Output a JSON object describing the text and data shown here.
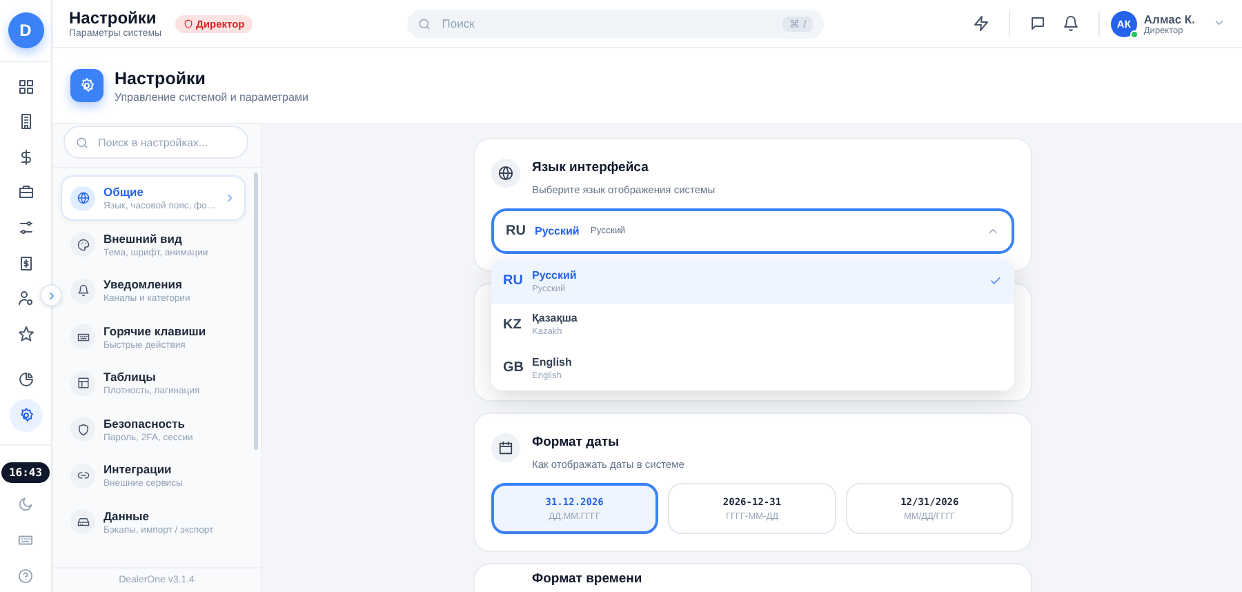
{
  "rail": {
    "logo": "D",
    "items": [
      {
        "selected": false
      },
      {
        "selected": false
      },
      {
        "selected": false
      },
      {
        "selected": false
      },
      {
        "selected": false
      },
      {
        "selected": false
      },
      {
        "selected": false
      },
      {
        "selected": false
      },
      {
        "selected": false
      },
      {
        "selected": true
      }
    ],
    "clock": "16:43"
  },
  "header": {
    "title": "Настройки",
    "subtitle": "Параметры системы",
    "role_badge": "Директор",
    "search": {
      "placeholder": "Поиск",
      "shortcut": "⌘ /"
    },
    "user": {
      "initials": "АК",
      "name": "Алмас К.",
      "role": "Директор",
      "online": true
    }
  },
  "page": {
    "title": "Настройки",
    "subtitle": "Управление системой и параметрами"
  },
  "settings_nav": {
    "search": {
      "placeholder": "Поиск в настройках..."
    },
    "items": [
      {
        "title": "Общие",
        "subtitle": "Язык, часовой пояс, фо...",
        "selected": true
      },
      {
        "title": "Внешний вид",
        "subtitle": "Тема, шрифт, анимации",
        "selected": false
      },
      {
        "title": "Уведомления",
        "subtitle": "Каналы и категории",
        "selected": false
      },
      {
        "title": "Горячие клавиши",
        "subtitle": "Быстрые действия",
        "selected": false
      },
      {
        "title": "Таблицы",
        "subtitle": "Плотность, пагинация",
        "selected": false
      },
      {
        "title": "Безопасность",
        "subtitle": "Пароль, 2FA, сессии",
        "selected": false
      },
      {
        "title": "Интеграции",
        "subtitle": "Внешние сервисы",
        "selected": false
      },
      {
        "title": "Данные",
        "subtitle": "Бэкапы, импорт / экспорт",
        "selected": false
      }
    ],
    "version": "DealerOne v3.1.4"
  },
  "language_card": {
    "title": "Язык интерфейса",
    "subtitle": "Выберите язык отображения системы",
    "select": {
      "code": "RU",
      "label": "Русский",
      "native": "Русский",
      "expanded": true
    },
    "options": [
      {
        "code": "RU",
        "label": "Русский",
        "native": "Русский",
        "selected": true
      },
      {
        "code": "KZ",
        "label": "Қазақша",
        "native": "Kazakh",
        "selected": false
      },
      {
        "code": "GB",
        "label": "English",
        "native": "English",
        "selected": false
      }
    ]
  },
  "date_card": {
    "title": "Формат даты",
    "subtitle": "Как отображать даты в системе",
    "options": [
      {
        "sample": "31.12.2026",
        "pattern": "ДД.ММ.ГГГГ",
        "selected": true
      },
      {
        "sample": "2026-12-31",
        "pattern": "ГГГГ-ММ-ДД",
        "selected": false
      },
      {
        "sample": "12/31/2026",
        "pattern": "ММ/ДД/ГГГГ",
        "selected": false
      }
    ]
  },
  "time_card": {
    "title": "Формат времени"
  }
}
